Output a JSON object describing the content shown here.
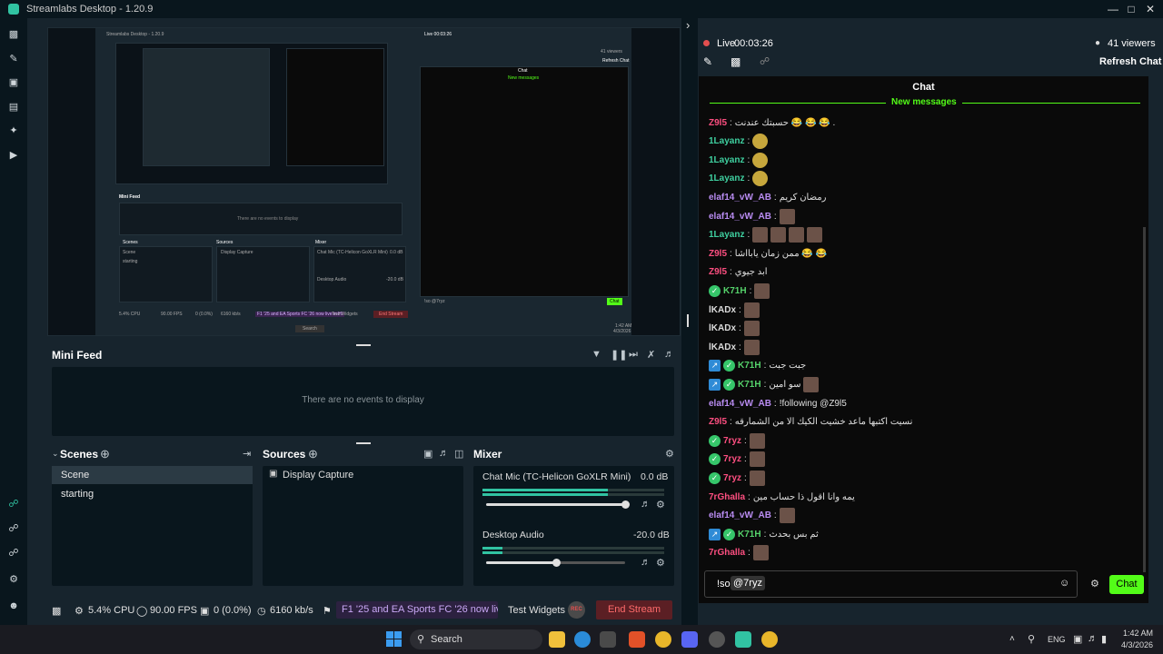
{
  "app": {
    "title": "Streamlabs Desktop - 1.20.9"
  },
  "colors": {
    "accent": "#31c3a2",
    "live": "#e34f4f",
    "chat_green": "#53fc18",
    "stream_end": "#5b1f24"
  },
  "preview": {
    "inner_title": "Streamlabs Desktop - 1.20.9",
    "inner_minifeed": "Mini Feed",
    "inner_no_events": "There are no events to display",
    "inner_scenes": "Scenes",
    "inner_sources": "Sources",
    "inner_mixer": "Mixer",
    "inner_scene_item": "Scene",
    "inner_starting": "starting",
    "inner_display_capture": "Display Capture",
    "inner_chat_mic": "Chat Mic (TC-Helicon GoXLR Mini)",
    "inner_desktop_audio": "Desktop Audio",
    "inner_db1": "0.0 dB",
    "inner_db2": "-20.0 dB",
    "inner_live": "Live 00:03:26",
    "inner_viewers": "41 viewers",
    "inner_refresh": "Refresh Chat",
    "inner_chat": "Chat",
    "inner_new_messages": "New messages",
    "inner_input": "!so @7ryz",
    "inner_chat_btn": "Chat",
    "inner_end": "End Stream",
    "inner_test": "Test Widgets",
    "inner_search": "Search",
    "inner_ticker": "F1 '25 and EA Sports FC '26 now live in Hi",
    "inner_stats": [
      "5.4% CPU",
      "90.00 FPS",
      "0 (0.0%)",
      "6160 kb/s"
    ],
    "inner_time": "1:42 AM",
    "inner_date": "4/3/2026"
  },
  "minifeed": {
    "title": "Mini Feed",
    "empty": "There are no events to display"
  },
  "scenes": {
    "title": "Scenes",
    "items": [
      "Scene",
      "starting"
    ]
  },
  "sources": {
    "title": "Sources",
    "items": [
      "Display Capture"
    ]
  },
  "mixer": {
    "title": "Mixer",
    "channels": [
      {
        "name": "Chat Mic (TC-Helicon GoXLR Mini)",
        "db": "0.0 dB",
        "volume": 1.0
      },
      {
        "name": "Desktop Audio",
        "db": "-20.0 dB",
        "volume": 0.5
      }
    ]
  },
  "status": {
    "cpu": "5.4% CPU",
    "fps": "90.00 FPS",
    "dropped": "0 (0.0%)",
    "bitrate": "6160 kb/s",
    "ticker": "F1 '25 and EA Sports FC '26 now live in Hi",
    "test_widgets": "Test Widgets",
    "rec": "REC",
    "end_stream": "End Stream"
  },
  "chat": {
    "live_label": "Live",
    "live_time": "00:03:26",
    "viewers": "41 viewers",
    "refresh": "Refresh Chat",
    "header": "Chat",
    "new_messages": "New messages",
    "input_value": "!so",
    "input_mention": "@7ryz",
    "send": "Chat",
    "messages": [
      {
        "user": "Z9l5",
        "color": "#ff4f81",
        "text": "حسبتك عندنت 😂 😂 😂 .",
        "emotes": 0,
        "badges": []
      },
      {
        "user": "1Layanz",
        "color": "#3fd0a0",
        "text": "",
        "emotes": 1,
        "pepe": true,
        "badges": []
      },
      {
        "user": "1Layanz",
        "color": "#3fd0a0",
        "text": "",
        "emotes": 1,
        "pepe": true,
        "badges": []
      },
      {
        "user": "1Layanz",
        "color": "#3fd0a0",
        "text": "",
        "emotes": 1,
        "pepe": true,
        "badges": []
      },
      {
        "user": "elaf14_vW_AB",
        "color": "#b98cf2",
        "text": "رمضان كريم",
        "emotes": 0,
        "badges": []
      },
      {
        "user": "elaf14_vW_AB",
        "color": "#b98cf2",
        "text": "",
        "emotes": 1,
        "badges": []
      },
      {
        "user": "1Layanz",
        "color": "#3fd0a0",
        "text": "",
        "emotes": 4,
        "badges": []
      },
      {
        "user": "Z9l5",
        "color": "#ff4f81",
        "text": "ممن زمان يابااشا 😂 😂",
        "emotes": 0,
        "badges": []
      },
      {
        "user": "Z9l5",
        "color": "#ff4f81",
        "text": "ابد جيوي",
        "emotes": 0,
        "badges": []
      },
      {
        "user": "K71H",
        "color": "#55d36b",
        "text": "",
        "emotes": 1,
        "badges": [
          "check"
        ]
      },
      {
        "user": "lKADx",
        "color": "#dcdcdc",
        "text": "",
        "emotes": 1,
        "badges": []
      },
      {
        "user": "lKADx",
        "color": "#dcdcdc",
        "text": "",
        "emotes": 1,
        "badges": []
      },
      {
        "user": "lKADx",
        "color": "#dcdcdc",
        "text": "",
        "emotes": 1,
        "badges": []
      },
      {
        "user": "K71H",
        "color": "#55d36b",
        "text": "جبت جبت",
        "emotes": 0,
        "badges": [
          "sq",
          "check"
        ]
      },
      {
        "user": "K71H",
        "color": "#55d36b",
        "text": "سو امين",
        "emotes": 1,
        "badges": [
          "sq",
          "check"
        ]
      },
      {
        "user": "elaf14_vW_AB",
        "color": "#b98cf2",
        "text": "!following @Z9l5",
        "emotes": 0,
        "badges": []
      },
      {
        "user": "Z9l5",
        "color": "#ff4f81",
        "text": "نسيت اكتبها ماعد خشيت الكيك الا من الشمارقه",
        "emotes": 0,
        "badges": []
      },
      {
        "user": "7ryz",
        "color": "#ff4f81",
        "text": "",
        "emotes": 1,
        "badges": [
          "check"
        ]
      },
      {
        "user": "7ryz",
        "color": "#ff4f81",
        "text": "",
        "emotes": 1,
        "badges": [
          "check"
        ]
      },
      {
        "user": "7ryz",
        "color": "#ff4f81",
        "text": "",
        "emotes": 1,
        "badges": [
          "check"
        ]
      },
      {
        "user": "7rGhalla",
        "color": "#ff4f81",
        "text": "يمه وانا اقول ذا حساب مين",
        "emotes": 0,
        "badges": []
      },
      {
        "user": "elaf14_vW_AB",
        "color": "#b98cf2",
        "text": "",
        "emotes": 1,
        "badges": []
      },
      {
        "user": "K71H",
        "color": "#55d36b",
        "text": "ثم بس بحدث",
        "emotes": 0,
        "badges": [
          "sq",
          "check"
        ]
      },
      {
        "user": "7rGhalla",
        "color": "#ff4f81",
        "text": "",
        "emotes": 1,
        "badges": []
      }
    ]
  },
  "taskbar": {
    "search": "Search",
    "lang": "ENG",
    "time": "1:42 AM",
    "date": "4/3/2026"
  }
}
